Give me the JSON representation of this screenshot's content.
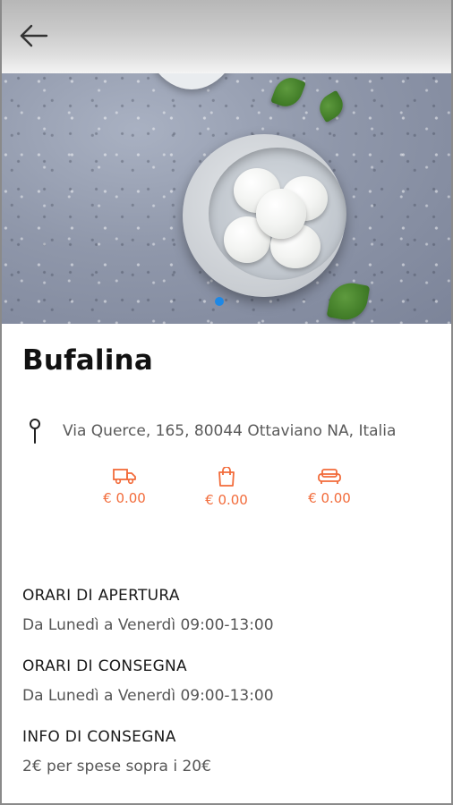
{
  "header": {
    "back_icon": "arrow-left-icon"
  },
  "hero": {
    "carousel_active_color": "#1e88e5"
  },
  "store": {
    "name": "Bufalina",
    "address_icon": "map-pin-icon",
    "address": "Via Querce, 165, 80044 Ottaviano NA, Italia"
  },
  "stats": [
    {
      "icon": "delivery-truck-icon",
      "value": "€ 0.00"
    },
    {
      "icon": "shopping-bag-icon",
      "value": "€ 0.00"
    },
    {
      "icon": "sofa-icon",
      "value": "€ 0.00"
    }
  ],
  "accent_color": "#f26b3a",
  "info": {
    "opening_title": "ORARI DI APERTURA",
    "opening_text": "Da Lunedì a Venerdì 09:00-13:00",
    "delivery_hours_title": "ORARI DI CONSEGNA",
    "delivery_hours_text": "Da Lunedì a Venerdì 09:00-13:00",
    "delivery_info_title": "INFO DI CONSEGNA",
    "delivery_info_text": "2€ per spese sopra i 20€"
  }
}
